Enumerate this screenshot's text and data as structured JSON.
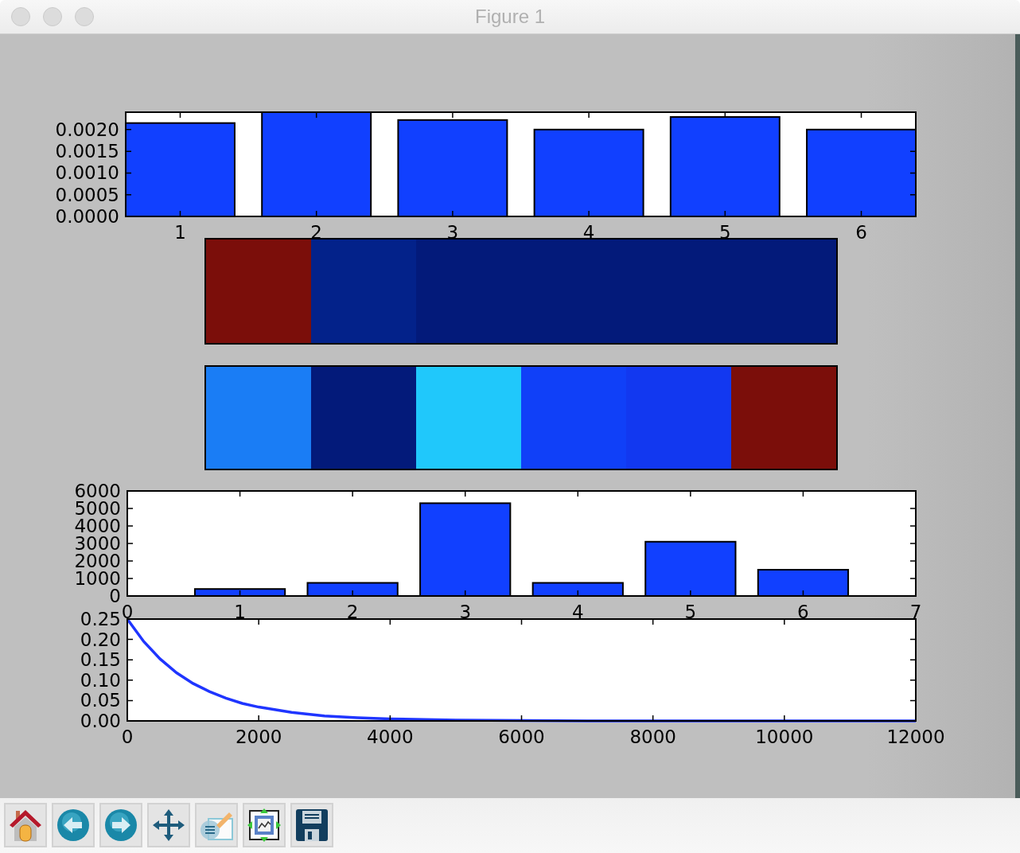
{
  "window": {
    "title": "Figure 1"
  },
  "figure": {
    "charts": [
      {
        "chart_data": {
          "type": "bar",
          "x": [
            1,
            2,
            3,
            4,
            5,
            6
          ],
          "values": [
            0.00215,
            0.0024,
            0.00222,
            0.002,
            0.00229,
            0.002
          ],
          "xlim": [
            0.6,
            6.4
          ],
          "ylim": [
            0,
            0.0024
          ],
          "xticks": [
            1,
            2,
            3,
            4,
            5,
            6
          ],
          "yticks": [
            {
              "value": 0,
              "label": "0.0000"
            },
            {
              "value": 0.0005,
              "label": "0.0005"
            },
            {
              "value": 0.001,
              "label": "0.0010"
            },
            {
              "value": 0.0015,
              "label": "0.0015"
            },
            {
              "value": 0.002,
              "label": "0.0020"
            }
          ]
        }
      },
      {
        "chart_data": {
          "type": "bar",
          "x": [
            1,
            2,
            3,
            4,
            5,
            6
          ],
          "values": [
            400,
            750,
            5300,
            750,
            3100,
            1500
          ],
          "xlim": [
            0,
            7
          ],
          "ylim": [
            0,
            6000
          ],
          "xticks": [
            0,
            1,
            2,
            3,
            4,
            5,
            6,
            7
          ],
          "yticks": [
            0,
            1000,
            2000,
            3000,
            4000,
            5000,
            6000
          ]
        }
      },
      {
        "chart_data": {
          "type": "line",
          "x": [
            0,
            250,
            500,
            750,
            1000,
            1250,
            1500,
            1750,
            2000,
            2500,
            3000,
            3500,
            4000,
            5000,
            6000,
            7000,
            8000,
            9000,
            10000,
            11000,
            12000
          ],
          "series": [
            {
              "color": "#1f35ff",
              "values": [
                0.25,
                0.195,
                0.152,
                0.118,
                0.092,
                0.072,
                0.056,
                0.043,
                0.034,
                0.021,
                0.012,
                0.008,
                0.005,
                0.002,
                0.001,
                0,
                0,
                0,
                0,
                0,
                0
              ]
            }
          ],
          "xlim": [
            0,
            12000
          ],
          "ylim": [
            0,
            0.25
          ],
          "xticks": [
            0,
            2000,
            4000,
            6000,
            8000,
            10000,
            12000
          ],
          "yticks": [
            {
              "value": 0,
              "label": "0.00"
            },
            {
              "value": 0.05,
              "label": "0.05"
            },
            {
              "value": 0.1,
              "label": "0.10"
            },
            {
              "value": 0.15,
              "label": "0.15"
            },
            {
              "value": 0.2,
              "label": "0.20"
            },
            {
              "value": 0.25,
              "label": "0.25"
            }
          ]
        }
      }
    ],
    "heatmaps": [
      {
        "cells": [
          {
            "color": "#7b0e0a"
          },
          {
            "color": "#03228a"
          },
          {
            "color": "#031a7a"
          },
          {
            "color": "#031a7a"
          },
          {
            "color": "#031a7a"
          },
          {
            "color": "#031a7a"
          }
        ]
      },
      {
        "cells": [
          {
            "color": "#1a7df5"
          },
          {
            "color": "#031a7a"
          },
          {
            "color": "#20c8fb"
          },
          {
            "color": "#1040f8"
          },
          {
            "color": "#1238f0"
          },
          {
            "color": "#7b0e0a"
          }
        ]
      }
    ]
  },
  "toolbar": [
    {
      "kind": "home"
    },
    {
      "kind": "back"
    },
    {
      "kind": "forward"
    },
    {
      "kind": "pan"
    },
    {
      "kind": "edit"
    },
    {
      "kind": "subplots"
    },
    {
      "kind": "save"
    }
  ]
}
